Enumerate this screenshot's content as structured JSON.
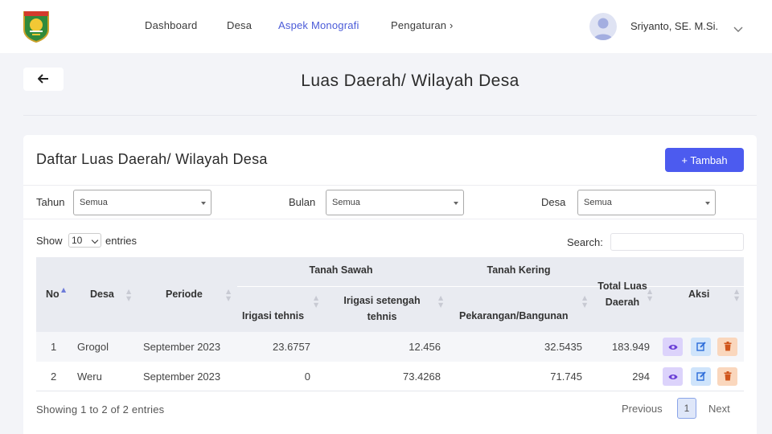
{
  "nav": {
    "items": [
      "Dashboard",
      "Desa",
      "Aspek Monografi",
      "Pengaturan ›"
    ],
    "active": "Aspek Monografi",
    "user_name": "Sriyanto, SE. M.Si."
  },
  "page": {
    "title": "Luas Daerah/ Wilayah Desa"
  },
  "card": {
    "title": "Daftar Luas Daerah/ Wilayah Desa",
    "add_label": "+ Tambah"
  },
  "filters": [
    {
      "label": "Tahun",
      "value": "Semua"
    },
    {
      "label": "Bulan",
      "value": "Semua"
    },
    {
      "label": "Desa",
      "value": "Semua"
    }
  ],
  "table_controls": {
    "show_label": "Show",
    "page_size": "10",
    "entries_label": "entries",
    "search_label": "Search:"
  },
  "table": {
    "headers": {
      "no": "No",
      "desa": "Desa",
      "periode": "Periode",
      "tanah_sawah": "Tanah Sawah",
      "irigasi_tehnis": "Irigasi tehnis",
      "irigasi_setengah_1": "Irigasi setengah",
      "irigasi_setengah_2": "tehnis",
      "tanah_kering": "Tanah Kering",
      "pekarangan": "Pekarangan/Bangunan",
      "total_1": "Total Luas",
      "total_2": "Daerah",
      "aksi": "Aksi"
    },
    "rows": [
      {
        "no": "1",
        "desa": "Grogol",
        "periode": "September 2023",
        "irigasi_tehnis": "23.6757",
        "irigasi_setengah": "12.456",
        "pekarangan": "32.5435",
        "total": "183.949"
      },
      {
        "no": "2",
        "desa": "Weru",
        "periode": "September 2023",
        "irigasi_tehnis": "0",
        "irigasi_setengah": "73.4268",
        "pekarangan": "71.745",
        "total": "294"
      }
    ]
  },
  "footer": {
    "info": "Showing 1 to 2 of 2 entries",
    "prev": "Previous",
    "current_page": "1",
    "next": "Next"
  },
  "colors": {
    "primary": "#4c5bef",
    "nav_active": "#4b5bd8",
    "view_btn": "#dcd3fb",
    "edit_btn": "#cfe4fb",
    "delete_btn": "#fad7bd"
  }
}
